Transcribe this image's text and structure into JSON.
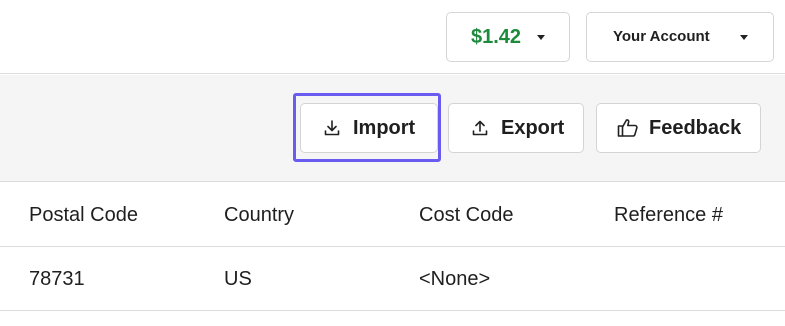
{
  "topbar": {
    "balance": {
      "amount": "$1.42",
      "amount_color": "#1d8a3c",
      "icon": "chevron-down-icon"
    },
    "account": {
      "label": "Your Account",
      "icon": "chevron-down-icon"
    }
  },
  "toolbar": {
    "import_label": "Import",
    "import_icon": "download-icon",
    "export_label": "Export",
    "export_icon": "upload-icon",
    "feedback_label": "Feedback",
    "feedback_icon": "thumbs-up-icon",
    "focus_color": "#6a5cf0"
  },
  "table": {
    "columns": [
      "Postal Code",
      "Country",
      "Cost Code",
      "Reference #"
    ],
    "rows": [
      [
        "78731",
        "US",
        "<None>",
        ""
      ]
    ]
  }
}
